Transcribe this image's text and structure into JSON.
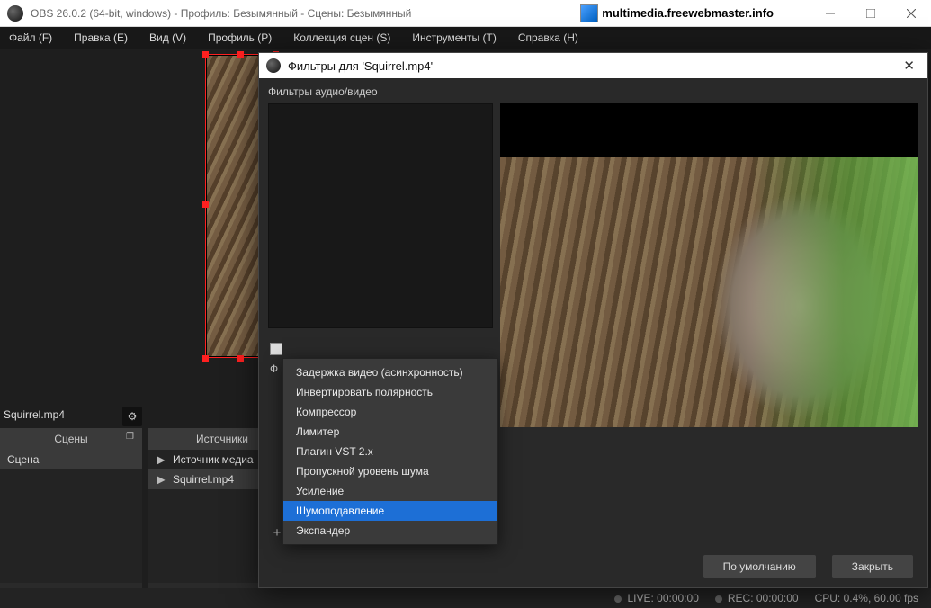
{
  "window": {
    "title": "OBS 26.0.2 (64-bit, windows) - Профиль: Безымянный - Сцены: Безымянный",
    "branding": "multimedia.freewebmaster.info"
  },
  "menu": {
    "file": "Файл (F)",
    "edit": "Правка (E)",
    "view": "Вид (V)",
    "profile": "Профиль (P)",
    "sceneCollection": "Коллекция сцен (S)",
    "tools": "Инструменты (T)",
    "help": "Справка (H)"
  },
  "preview": {
    "fileLabel": "Squirrel.mp4"
  },
  "scenes": {
    "header": "Сцены",
    "items": [
      "Сцена"
    ]
  },
  "sources": {
    "header": "Источники",
    "items": [
      "Источник медиа",
      "Squirrel.mp4"
    ]
  },
  "toolbar": {
    "plus": "+",
    "minus": "−",
    "up": "∧",
    "down": "∨",
    "gear": "⚙"
  },
  "modal": {
    "title": "Фильтры для 'Squirrel.mp4'",
    "section1": "Фильтры аудио/видео",
    "phShort": "Ф",
    "defaults": "По умолчанию",
    "close": "Закрыть"
  },
  "contextMenu": {
    "items": [
      "Задержка видео (асинхронность)",
      "Инвертировать полярность",
      "Компрессор",
      "Лимитер",
      "Плагин VST 2.x",
      "Пропускной уровень шума",
      "Усиление",
      "Шумоподавление",
      "Экспандер"
    ],
    "highlightIndex": 7
  },
  "status": {
    "live": "LIVE: 00:00:00",
    "rec": "REC: 00:00:00",
    "cpu": "CPU: 0.4%, 60.00 fps"
  }
}
